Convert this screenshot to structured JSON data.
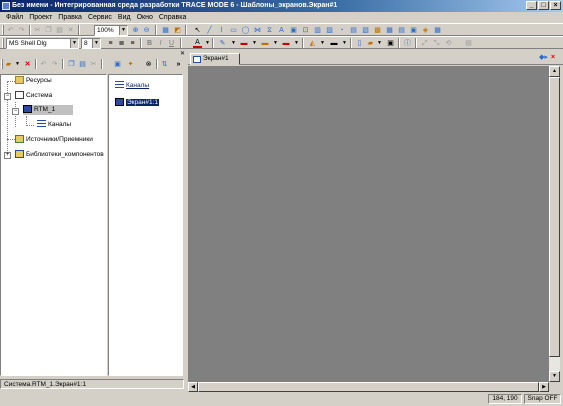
{
  "window": {
    "title": "Без имени - Интегрированная среда разработки TRACE MODE 6 - Шаблоны_экранов.Экран#1",
    "minimize": "_",
    "maximize": "□",
    "close": "×"
  },
  "menu": [
    "Файл",
    "Проект",
    "Правка",
    "Сервис",
    "Вид",
    "Окно",
    "Справка"
  ],
  "toolbar": {
    "zoom": "100%",
    "font_name": "MS Shell Dlg",
    "font_size": "8",
    "bold": "B",
    "italic": "I",
    "underline": "U"
  },
  "tree": {
    "items": [
      {
        "label": "Ресурсы",
        "icon": "resources-folder-icon"
      },
      {
        "label": "Система",
        "icon": "system-network-icon"
      },
      {
        "label": "RTM_1",
        "icon": "rtm-node-icon"
      },
      {
        "label": "Каналы",
        "icon": "channels-icon"
      },
      {
        "label": "Источники/Приемники",
        "icon": "sources-sinks-icon"
      },
      {
        "label": "Библиотеки_компонентов",
        "icon": "component-libraries-icon"
      }
    ]
  },
  "list": {
    "items": [
      {
        "label": "Каналы",
        "icon": "channels-icon"
      },
      {
        "label": "Экран#1:1",
        "icon": "screen-channel-icon"
      }
    ]
  },
  "status": {
    "path": "Система.RTM_1.Экран#1:1",
    "coords": "184, 190",
    "snap": "Snap OFF"
  },
  "document": {
    "tab_label": "Экран#1",
    "nav_arrows": "◆▸",
    "close": "×"
  },
  "colors": {
    "title_gradient_start": "#0a246a",
    "canvas_background": "#808080",
    "selection": "#0a246a"
  }
}
